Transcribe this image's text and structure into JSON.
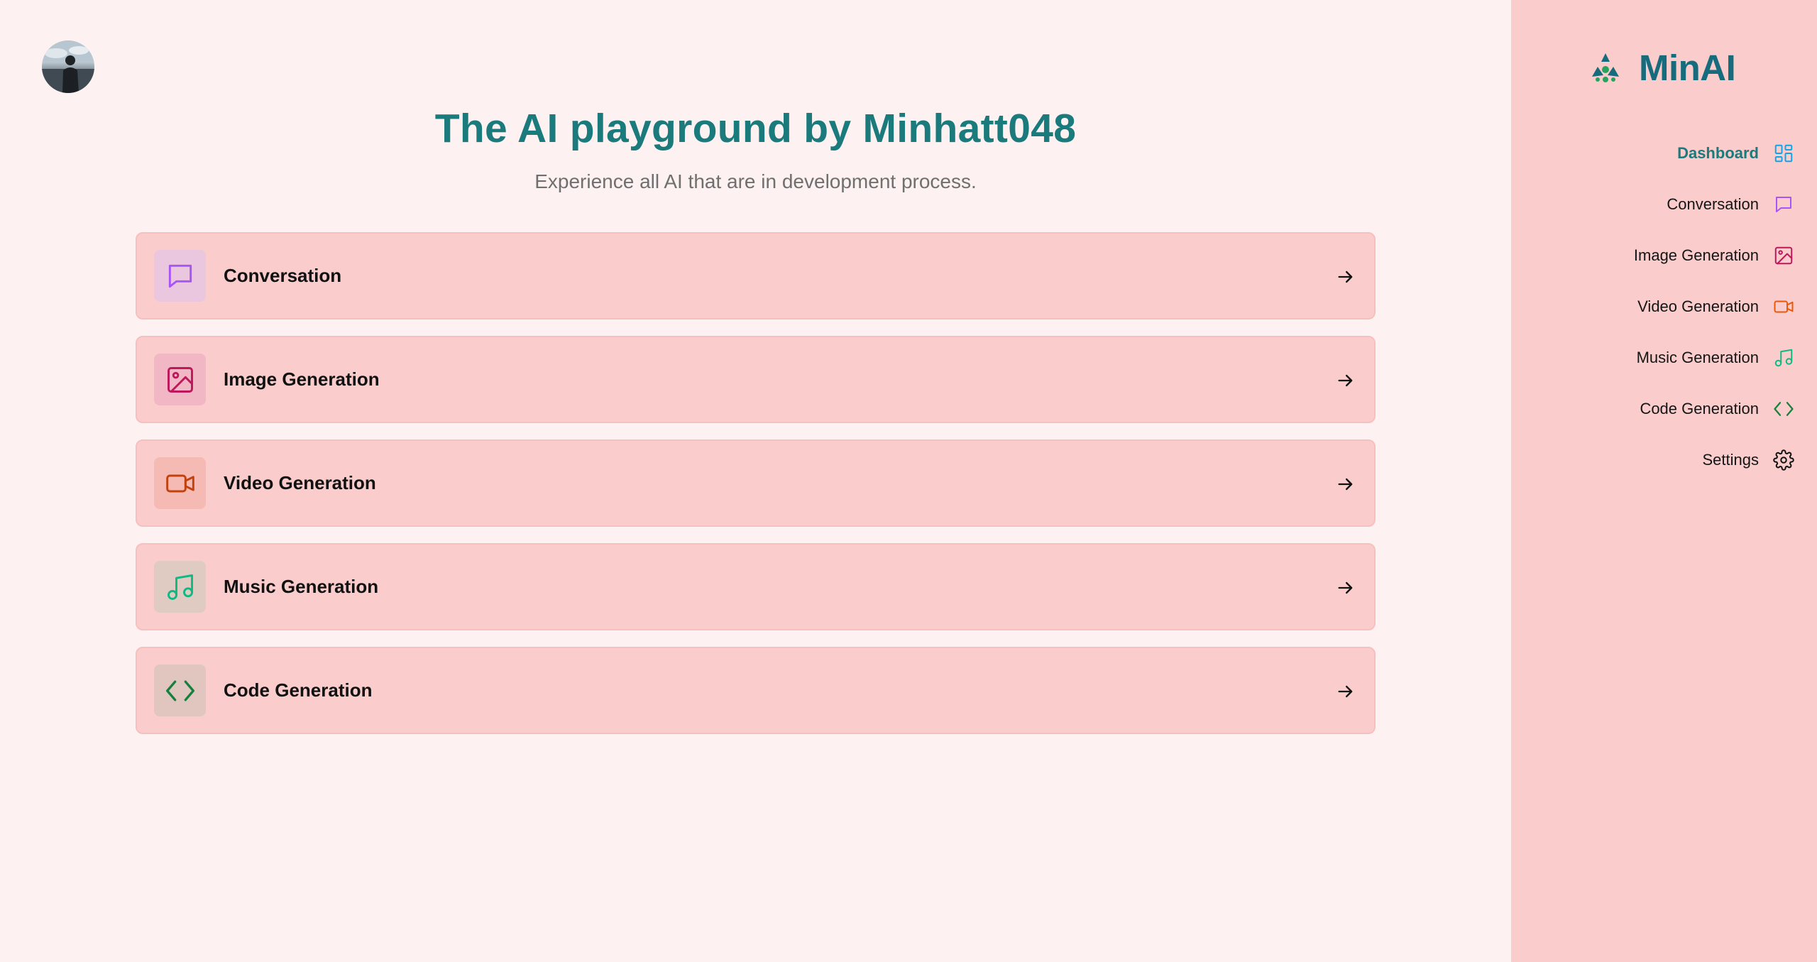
{
  "header": {
    "title": "The AI playground by Minhatt048",
    "subtitle": "Experience all AI that are in development process."
  },
  "avatar": {
    "icon": "user-avatar-photo"
  },
  "cards": [
    {
      "label": "Conversation",
      "icon": "chat-bubble-icon",
      "color": "#a855f7",
      "bg": "#eac7de"
    },
    {
      "label": "Image Generation",
      "icon": "image-icon",
      "color": "#be185d",
      "bg": "#f2b7c4"
    },
    {
      "label": "Video Generation",
      "icon": "video-camera-icon",
      "color": "#c2410c",
      "bg": "#f6bab4"
    },
    {
      "label": "Music Generation",
      "icon": "music-note-icon",
      "color": "#10b981",
      "bg": "#e0cbc3"
    },
    {
      "label": "Code Generation",
      "icon": "code-brackets-icon",
      "color": "#15803d",
      "bg": "#e1c5bf"
    }
  ],
  "sidebar": {
    "brand": "MinAI",
    "items": [
      {
        "label": "Dashboard",
        "icon": "dashboard-icon",
        "color": "#0ea5e9",
        "active": true
      },
      {
        "label": "Conversation",
        "icon": "chat-bubble-icon",
        "color": "#a855f7",
        "active": false
      },
      {
        "label": "Image Generation",
        "icon": "image-icon",
        "color": "#be185d",
        "active": false
      },
      {
        "label": "Video Generation",
        "icon": "video-camera-icon",
        "color": "#ea580c",
        "active": false
      },
      {
        "label": "Music Generation",
        "icon": "music-note-icon",
        "color": "#10b981",
        "active": false
      },
      {
        "label": "Code Generation",
        "icon": "code-brackets-icon",
        "color": "#15803d",
        "active": false
      },
      {
        "label": "Settings",
        "icon": "gear-icon",
        "color": "#111111",
        "active": false
      }
    ]
  },
  "colors": {
    "accent": "#1b7a7c",
    "brand": "#166b7c",
    "sidebar_bg": "#facdcc",
    "main_bg": "#fdf2f1"
  }
}
